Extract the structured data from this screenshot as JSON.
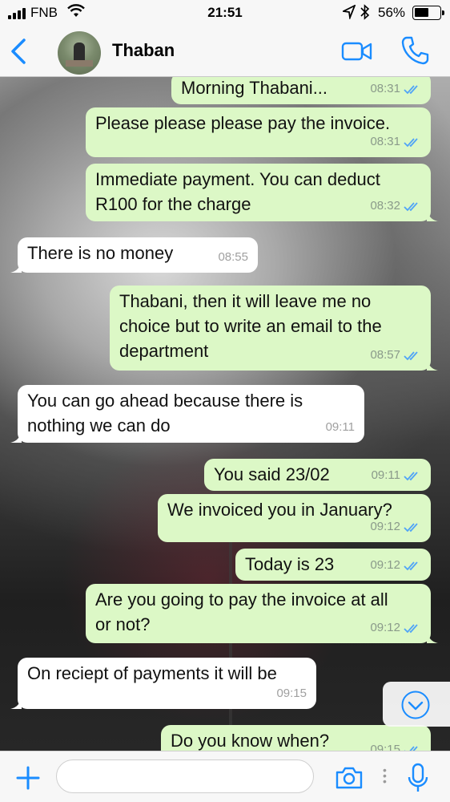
{
  "status_bar": {
    "carrier": "FNB",
    "time": "21:51",
    "battery_percent": "56%",
    "battery_level": 0.56
  },
  "header": {
    "contact_name": "Thaban",
    "accent_color": "#1a8cff"
  },
  "messages": [
    {
      "dir": "out",
      "text": "Morning Thabani...",
      "time": "08:31"
    },
    {
      "dir": "out",
      "text": "Please please please pay the invoice.",
      "time": "08:31"
    },
    {
      "dir": "out",
      "text": "Immediate payment. You can deduct\nR100 for the charge",
      "time": "08:32"
    },
    {
      "dir": "in",
      "text": "There is no money",
      "time": "08:55"
    },
    {
      "dir": "out",
      "text": "Thabani, then it will leave me no\nchoice but to write an email to the\ndepartment",
      "time": "08:57"
    },
    {
      "dir": "in",
      "text": "You can go ahead because there is\nnothing we can do",
      "time": "09:11"
    },
    {
      "dir": "out",
      "text": "You said 23/02",
      "time": "09:11"
    },
    {
      "dir": "out",
      "text": "We invoiced you in January?",
      "time": "09:12"
    },
    {
      "dir": "out",
      "text": "Today is 23",
      "time": "09:12"
    },
    {
      "dir": "out",
      "text": "Are you going to pay the invoice at all\nor not?",
      "time": "09:12"
    },
    {
      "dir": "in",
      "text": "On reciept of payments it will be",
      "time": "09:15"
    },
    {
      "dir": "out",
      "text": "Do you know when?",
      "time": "09:15"
    }
  ],
  "input_bar": {
    "placeholder": ""
  },
  "colors": {
    "outgoing_bubble": "#dcf8c6",
    "incoming_bubble": "#ffffff",
    "read_ticks": "#4fa3f7"
  }
}
